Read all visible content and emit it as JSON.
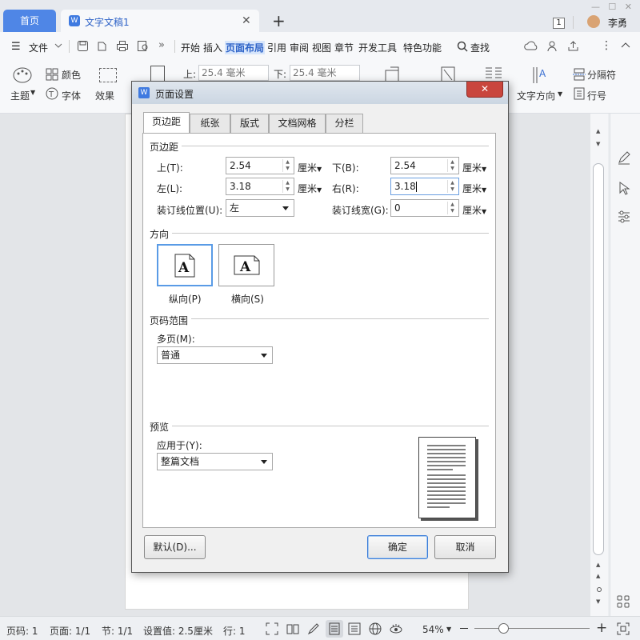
{
  "tabs": {
    "home": "首页",
    "doc": "文字文稿1",
    "new": "+"
  },
  "user": {
    "badge": "1",
    "name": "李勇"
  },
  "menubar": {
    "file": "文件",
    "items": [
      "开始",
      "插入",
      "页面布局",
      "引用",
      "审阅",
      "视图",
      "章节",
      "开发工具",
      "特色功能"
    ],
    "search": "查找"
  },
  "ribbon": {
    "theme": "主题",
    "color": "颜色",
    "font": "字体",
    "effect": "效果",
    "top_label": "上:",
    "top_value": "25.4 毫米",
    "bottom_label": "下:",
    "bottom_value": "25.4 毫米",
    "text_dir": "文字方向",
    "separator": "分隔符",
    "line_no": "行号"
  },
  "dialog": {
    "title": "页面设置",
    "close": "✕",
    "tabs": [
      "页边距",
      "纸张",
      "版式",
      "文档网格",
      "分栏"
    ],
    "margins_group": "页边距",
    "top_label": "上(T):",
    "top_value": "2.54",
    "bottom_label": "下(B):",
    "bottom_value": "2.54",
    "left_label": "左(L):",
    "left_value": "3.18",
    "right_label": "右(R):",
    "right_value": "3.18",
    "unit": "厘米",
    "gutter_pos_label": "装订线位置(U):",
    "gutter_pos_value": "左",
    "gutter_width_label": "装订线宽(G):",
    "gutter_width_value": "0",
    "orientation_group": "方向",
    "portrait": "纵向(P)",
    "landscape": "横向(S)",
    "pages_group": "页码范围",
    "multi_label": "多页(M):",
    "multi_value": "普通",
    "preview_group": "预览",
    "apply_label": "应用于(Y):",
    "apply_value": "整篇文档",
    "default_btn": "默认(D)...",
    "ok_btn": "确定",
    "cancel_btn": "取消"
  },
  "status": {
    "page_num": "页码: 1",
    "pages": "页面: 1/1",
    "section": "节: 1/1",
    "setting": "设置值: 2.5厘米",
    "row": "行: 1",
    "zoom": "54%"
  }
}
